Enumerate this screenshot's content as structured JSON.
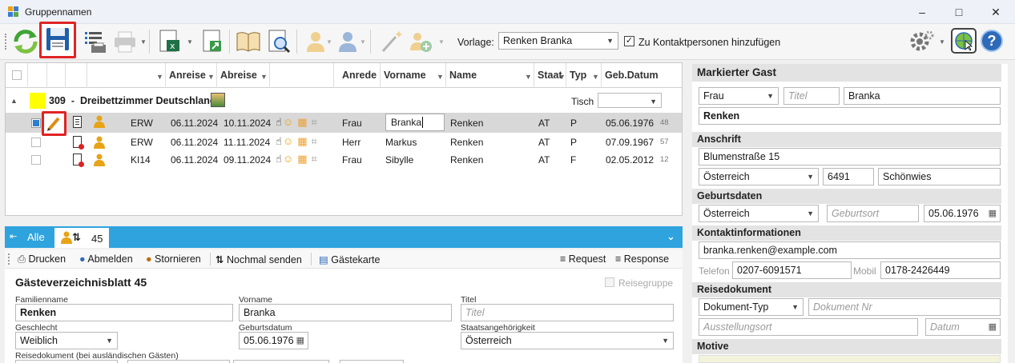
{
  "window": {
    "title": "Gruppennamen"
  },
  "toolbar": {
    "vorlage_label": "Vorlage:",
    "vorlage_value": "Renken Branka",
    "kontakt_label": "Zu Kontaktpersonen hinzufügen"
  },
  "grid": {
    "headers": [
      "Anreise",
      "Abreise",
      "Anrede",
      "Vorname",
      "Name",
      "Staat",
      "Typ",
      "Geb.Datum"
    ],
    "group": {
      "number": "309",
      "sep": "-",
      "name": "Dreibettzimmer Deutschland",
      "tisch_label": "Tisch"
    },
    "rows": [
      {
        "code": "ERW",
        "anreise": "06.11.2024",
        "abreise": "10.11.2024",
        "anrede": "Frau",
        "vorname": "Branka",
        "name": "Renken",
        "staat": "AT",
        "typ": "P",
        "geb": "05.06.1976",
        "age": "48"
      },
      {
        "code": "ERW",
        "anreise": "06.11.2024",
        "abreise": "11.11.2024",
        "anrede": "Herr",
        "vorname": "Markus",
        "name": "Renken",
        "staat": "AT",
        "typ": "P",
        "geb": "07.09.1967",
        "age": "57"
      },
      {
        "code": "KI14",
        "anreise": "06.11.2024",
        "abreise": "09.11.2024",
        "anrede": "Frau",
        "vorname": "Sibylle",
        "name": "Renken",
        "staat": "AT",
        "typ": "F",
        "geb": "02.05.2012",
        "age": "12"
      }
    ]
  },
  "tabs": {
    "all": "Alle",
    "selected_count": "45"
  },
  "subtoolbar": {
    "drucken": "Drucken",
    "abmelden": "Abmelden",
    "stornieren": "Stornieren",
    "nochmal": "Nochmal senden",
    "gaestekarte": "Gästekarte",
    "request": "Request",
    "response": "Response"
  },
  "form": {
    "title": "Gästeverzeichnisblatt 45",
    "reisegruppe": "Reisegruppe",
    "familienname_label": "Familienname",
    "familienname": "Renken",
    "vorname_label": "Vorname",
    "vorname": "Branka",
    "titel_label": "Titel",
    "titel_ph": "Titel",
    "geschlecht_label": "Geschlecht",
    "geschlecht": "Weiblich",
    "geburtsdatum_label": "Geburtsdatum",
    "geburtsdatum": "05.06.1976",
    "staat_label": "Staatsangehörigkeit",
    "staat": "Österreich",
    "reisedok_label": "Reisedokument (bei ausländischen Gästen)"
  },
  "right": {
    "title": "Markierter Gast",
    "anrede": "Frau",
    "titel_ph": "Titel",
    "vorname": "Branka",
    "name": "Renken",
    "anschrift_hdr": "Anschrift",
    "strasse": "Blumenstraße 15",
    "land": "Österreich",
    "plz": "6491",
    "ort": "Schönwies",
    "geburt_hdr": "Geburtsdaten",
    "geburtsland": "Österreich",
    "geburtsort_ph": "Geburtsort",
    "geburtsdatum": "05.06.1976",
    "kontakt_hdr": "Kontaktinformationen",
    "email": "branka.renken@example.com",
    "telefon_label": "Telefon",
    "telefon": "0207-6091571",
    "mobil_label": "Mobil",
    "mobil": "0178-2426449",
    "reisedok_hdr": "Reisedokument",
    "doktyp": "Dokument-Typ",
    "doknr_ph": "Dokument Nr",
    "ausstellungsort_ph": "Ausstellungsort",
    "datum_ph": "Datum",
    "motive_hdr": "Motive"
  },
  "colors": {
    "accent": "#2ea3de",
    "highlight": "#e02424",
    "group_yellow": "#ffff00"
  }
}
